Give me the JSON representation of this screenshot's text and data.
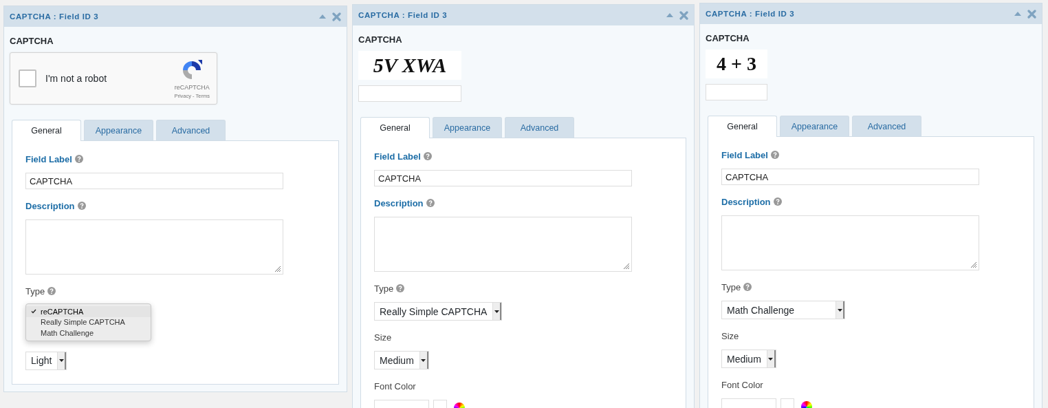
{
  "panels": [
    {
      "title": "CAPTCHA : Field ID 3",
      "preview_label": "CAPTCHA",
      "preview": {
        "kind": "recaptcha",
        "checkbox_label": "I'm not a robot",
        "checked": false,
        "brand": "reCAPTCHA",
        "links": "Privacy - Terms"
      },
      "tabs": [
        {
          "label": "General",
          "selected": true
        },
        {
          "label": "Appearance",
          "selected": false
        },
        {
          "label": "Advanced",
          "selected": false
        }
      ],
      "settings": [
        {
          "kind": "text",
          "label": "Field Label",
          "highlighted": true,
          "help": true,
          "value": "CAPTCHA"
        },
        {
          "kind": "textarea",
          "label": "Description",
          "highlighted": true,
          "help": true
        },
        {
          "kind": "menu",
          "label": "Type",
          "highlighted": false,
          "help": true,
          "options": [
            {
              "label": "reCAPTCHA",
              "selected": true
            },
            {
              "label": "Really Simple CAPTCHA",
              "selected": false
            },
            {
              "label": "Math Challenge",
              "selected": false
            }
          ]
        },
        {
          "kind": "select",
          "value": "Light"
        }
      ]
    },
    {
      "title": "CAPTCHA : Field ID 3",
      "preview_label": "CAPTCHA",
      "preview": {
        "kind": "image",
        "captcha_text": "5V XWA"
      },
      "tabs": [
        {
          "label": "General",
          "selected": true
        },
        {
          "label": "Appearance",
          "selected": false
        },
        {
          "label": "Advanced",
          "selected": false
        }
      ],
      "settings": [
        {
          "kind": "text",
          "label": "Field Label",
          "highlighted": true,
          "help": true,
          "value": "CAPTCHA"
        },
        {
          "kind": "textarea",
          "label": "Description",
          "highlighted": true,
          "help": true
        },
        {
          "kind": "select",
          "label": "Type",
          "highlighted": false,
          "help": true,
          "value": "Really Simple CAPTCHA"
        },
        {
          "kind": "select",
          "label": "Size",
          "highlighted": false,
          "help": false,
          "value": "Medium"
        },
        {
          "kind": "color",
          "label": "Font Color",
          "highlighted": false,
          "help": false
        }
      ]
    },
    {
      "title": "CAPTCHA : Field ID 3",
      "preview_label": "CAPTCHA",
      "preview": {
        "kind": "math",
        "captcha_text": "4 + 3"
      },
      "tabs": [
        {
          "label": "General",
          "selected": true
        },
        {
          "label": "Appearance",
          "selected": false
        },
        {
          "label": "Advanced",
          "selected": false
        }
      ],
      "settings": [
        {
          "kind": "text",
          "label": "Field Label",
          "highlighted": true,
          "help": true,
          "value": "CAPTCHA"
        },
        {
          "kind": "textarea",
          "label": "Description",
          "highlighted": true,
          "help": true
        },
        {
          "kind": "select",
          "label": "Type",
          "highlighted": false,
          "help": true,
          "value": "Math Challenge"
        },
        {
          "kind": "select",
          "label": "Size",
          "highlighted": false,
          "help": false,
          "value": "Medium"
        },
        {
          "kind": "color",
          "label": "Font Color",
          "highlighted": false,
          "help": false
        }
      ]
    }
  ]
}
